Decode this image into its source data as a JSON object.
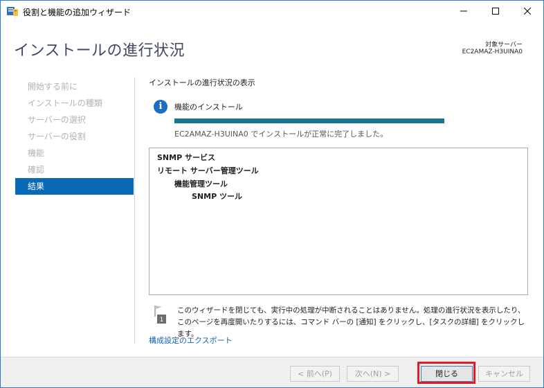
{
  "window": {
    "title": "役割と機能の追加ウィザード"
  },
  "header": {
    "page_title": "インストールの進行状況",
    "target_server_label": "対象サーバー",
    "target_server_name": "EC2AMAZ-H3UINA0"
  },
  "nav": {
    "items": [
      {
        "label": "開始する前に",
        "active": false
      },
      {
        "label": "インストールの種類",
        "active": false
      },
      {
        "label": "サーバーの選択",
        "active": false
      },
      {
        "label": "サーバーの役割",
        "active": false
      },
      {
        "label": "機能",
        "active": false
      },
      {
        "label": "確認",
        "active": false
      },
      {
        "label": "結果",
        "active": true
      }
    ]
  },
  "main": {
    "section_heading": "インストールの進行状況の表示",
    "feature_label": "機能のインストール",
    "progress_percent": 100,
    "status_text": "EC2AMAZ-H3UINA0 でインストールが正常に完了しました。",
    "results": [
      {
        "text": "SNMP サービス",
        "level": 0
      },
      {
        "text": "リモート サーバー管理ツール",
        "level": 0
      },
      {
        "text": "機能管理ツール",
        "level": 1
      },
      {
        "text": "SNMP ツール",
        "level": 2
      }
    ],
    "note_text": "このウィザードを閉じても、実行中の処理が中断されることはありません。処理の進行状況を表示したり、このページを再度開いたりするには、コマンド バーの [通知] をクリックし、[タスクの詳細] をクリックします。",
    "export_link": "構成設定のエクスポート"
  },
  "footer": {
    "prev_label": "< 前へ(P)",
    "next_label": "次へ(N) >",
    "close_label": "閉じる",
    "cancel_label": "キャンセル"
  },
  "colors": {
    "accent": "#0a69b5",
    "progress": "#1a7494",
    "highlight": "#e01b24"
  }
}
